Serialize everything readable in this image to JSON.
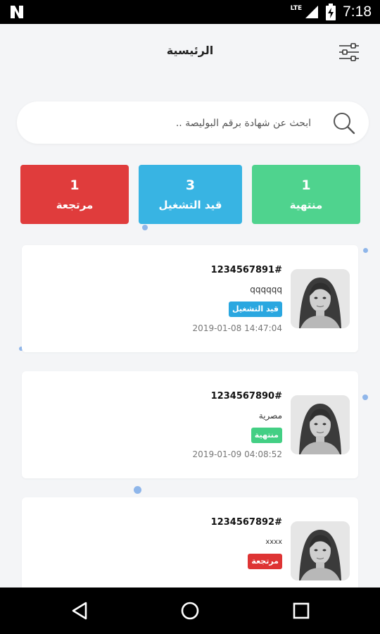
{
  "status_bar": {
    "network": "LTE",
    "battery_icon": "battery-charging-icon",
    "time": "7:18"
  },
  "header": {
    "title": "الرئيسية",
    "filter_icon": "filter-sliders-icon"
  },
  "search": {
    "placeholder": "ابحث عن شهادة برقم البوليصة ..",
    "value": ""
  },
  "stats": [
    {
      "key": "finished",
      "count": "1",
      "label": "منتهية",
      "color": "#4fd38e"
    },
    {
      "key": "running",
      "count": "3",
      "label": "قيد التشغيل",
      "color": "#38b4e3"
    },
    {
      "key": "returned",
      "count": "1",
      "label": "مرتجعة",
      "color": "#e03c3c"
    }
  ],
  "cards": [
    {
      "number": "1234567891#",
      "name": "qqqqqq",
      "status": "قيد التشغيل",
      "status_color": "#2aa7e0",
      "date": "2019-01-08 14:47:04"
    },
    {
      "number": "1234567890#",
      "name": "مصرية",
      "status": "منتهية",
      "status_color": "#43cf84",
      "date": "2019-01-09 04:08:52"
    },
    {
      "number": "1234567892#",
      "name": "xxxx",
      "status": "مرتجعة",
      "status_color": "#de3434",
      "date": ""
    }
  ],
  "nav": {
    "back_icon": "back-triangle-icon",
    "home_icon": "home-circle-icon",
    "recents_icon": "recents-square-icon"
  }
}
